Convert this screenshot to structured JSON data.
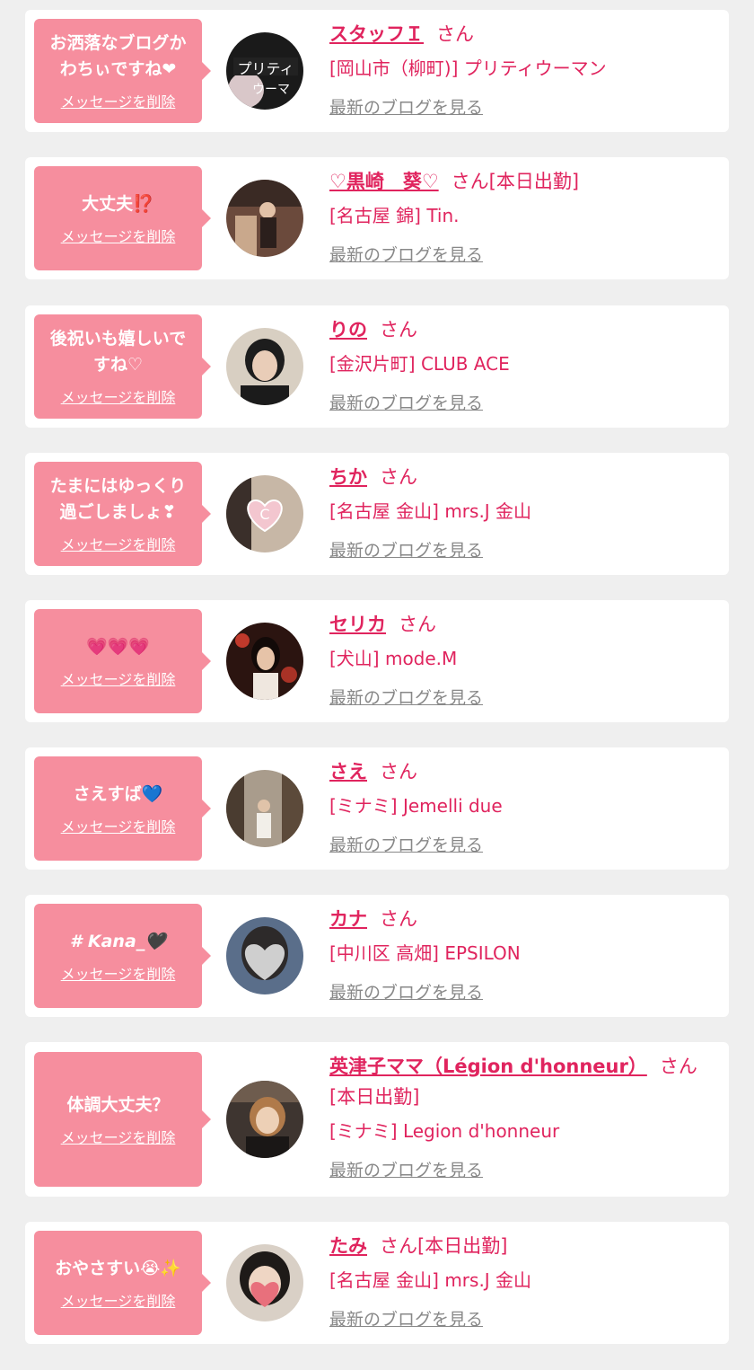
{
  "colors": {
    "accent": "#e0245e",
    "bubble": "#f68e9e",
    "background": "#efefef",
    "link_gray": "#888888"
  },
  "items": [
    {
      "message": "お洒落なブログかわちぃですね❤",
      "delete_label": "メッセージを削除",
      "name": "スタッフＩ",
      "suffix": "さん",
      "shop": "[岡山市（柳町)] プリティウーマン",
      "blog_link": "最新のブログを見る"
    },
    {
      "message": "大丈夫⁉️",
      "delete_label": "メッセージを削除",
      "name": "♡黒崎　葵♡",
      "suffix": "さん[本日出勤]",
      "shop": "[名古屋 錦] Tin.",
      "blog_link": "最新のブログを見る"
    },
    {
      "message": "後祝いも嬉しいですね♡",
      "delete_label": "メッセージを削除",
      "name": "りの",
      "suffix": "さん",
      "shop": "[金沢片町] CLUB ACE",
      "blog_link": "最新のブログを見る"
    },
    {
      "message": "たまにはゆっくり過ごしましょ❣",
      "delete_label": "メッセージを削除",
      "name": "ちか",
      "suffix": "さん",
      "shop": "[名古屋 金山] mrs.J 金山",
      "blog_link": "最新のブログを見る"
    },
    {
      "message": "💗💗💗",
      "delete_label": "メッセージを削除",
      "name": "セリカ",
      "suffix": "さん",
      "shop": "[犬山] mode.M",
      "blog_link": "最新のブログを見る"
    },
    {
      "message": "さえすば💙",
      "delete_label": "メッセージを削除",
      "name": "さえ",
      "suffix": "さん",
      "shop": "[ミナミ] Jemelli due",
      "blog_link": "最新のブログを見る"
    },
    {
      "message": "# Kana_🖤",
      "delete_label": "メッセージを削除",
      "name": "カナ",
      "suffix": "さん",
      "shop": "[中川区 高畑] EPSILON",
      "blog_link": "最新のブログを見る"
    },
    {
      "message": "体調大丈夫？",
      "delete_label": "メッセージを削除",
      "name": "英津子ママ（Légion d'honneur）",
      "suffix": "さん[本日出勤]",
      "shop": "[ミナミ] Legion d'honneur",
      "blog_link": "最新のブログを見る"
    },
    {
      "message": "おやさすい😭✨",
      "delete_label": "メッセージを削除",
      "name": "たみ",
      "suffix": "さん[本日出勤]",
      "shop": "[名古屋 金山] mrs.J 金山",
      "blog_link": "最新のブログを見る"
    }
  ]
}
